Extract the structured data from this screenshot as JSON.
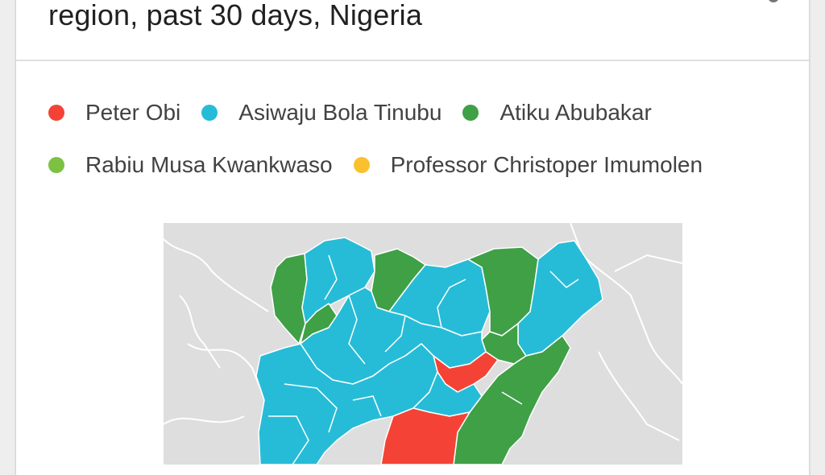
{
  "header": {
    "title": "region, past 30 days, Nigeria"
  },
  "legend": {
    "items": [
      {
        "label": "Peter Obi",
        "color": "#f44336"
      },
      {
        "label": "Asiwaju Bola Tinubu",
        "color": "#26bcd7"
      },
      {
        "label": "Atiku Abubakar",
        "color": "#3fa046"
      },
      {
        "label": "Rabiu Musa Kwankwaso",
        "color": "#7cc242"
      },
      {
        "label": "Professor Christoper Imumolen",
        "color": "#fbc02d"
      }
    ]
  },
  "map": {
    "country": "Nigeria",
    "background_color": "#dedede",
    "border_color": "#ffffff"
  },
  "icons": {
    "share": "share-icon"
  }
}
